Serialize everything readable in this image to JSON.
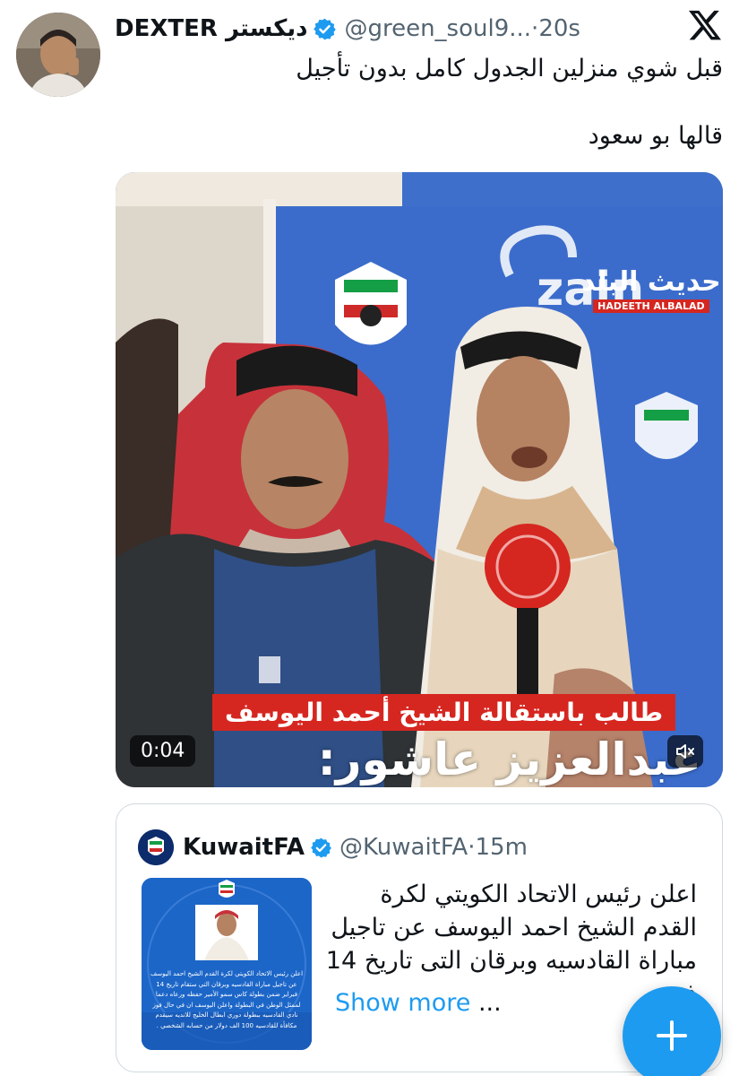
{
  "tweet": {
    "author_name": "DEXTER ديكستر",
    "handle": "@green_soul9...",
    "separator": "·",
    "time": "20s",
    "text_lines": [
      "قبل شوي منزلين الجدول كامل بدون تأجيل",
      "قالها بو سعود"
    ]
  },
  "video": {
    "duration": "0:04",
    "caption_red": "طالب باستقالة الشيخ أحمد اليوسف",
    "caption_big": "عبدالعزيز عاشور:",
    "watermark_ar": "حديث البلد",
    "watermark_en": "HADEETH ALBALAD",
    "backdrop_brand": "zain"
  },
  "quote": {
    "author_name": "KuwaitFA",
    "handle": "@KuwaitFA",
    "separator": "·",
    "time": "15m",
    "text": "اعلن رئيس الاتحاد الكويتي لكرة القدم الشيخ احمد اليوسف عن تاجيل مباراة القادسيه وبرقان التى تاريخ 14 ف",
    "ellipsis": "...",
    "show_more": "Show more",
    "thumbnail_text": "اعلن رئيس الاتحاد الكويتي لكرة القدم الشيخ احمد اليوسف عن تاجيل مباراة القادسيه وبرقان التي ستقام تاريخ 14 فبراير ضمن بطولة كاس سمو الأمير حفظه ورعاه دعما لممثل الوطن في البطولة واعلن اليوسف ان في حال فوز نادي القادسيه ببطولة دوري ابطال الخليج للانديه سيقدم مكافأة للقادسيه 100 الف دولار من حسابه الشخصي ."
  },
  "icons": {
    "verified": "verified-badge-icon",
    "x_logo": "x-logo-icon",
    "mute": "mute-icon",
    "compose": "plus-icon"
  },
  "colors": {
    "accent": "#1d9bf0",
    "text": "#0f1419",
    "muted": "#536471",
    "caption_red": "#d62620"
  }
}
